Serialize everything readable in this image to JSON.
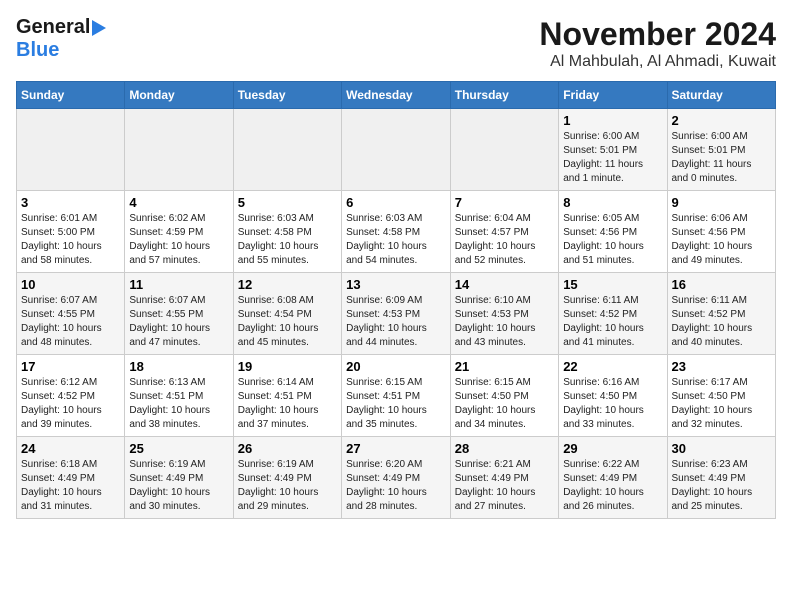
{
  "header": {
    "logo_line1": "General",
    "logo_line2": "Blue",
    "title": "November 2024",
    "subtitle": "Al Mahbulah, Al Ahmadi, Kuwait"
  },
  "days_of_week": [
    "Sunday",
    "Monday",
    "Tuesday",
    "Wednesday",
    "Thursday",
    "Friday",
    "Saturday"
  ],
  "weeks": [
    [
      {
        "day": "",
        "info": ""
      },
      {
        "day": "",
        "info": ""
      },
      {
        "day": "",
        "info": ""
      },
      {
        "day": "",
        "info": ""
      },
      {
        "day": "",
        "info": ""
      },
      {
        "day": "1",
        "info": "Sunrise: 6:00 AM\nSunset: 5:01 PM\nDaylight: 11 hours\nand 1 minute."
      },
      {
        "day": "2",
        "info": "Sunrise: 6:00 AM\nSunset: 5:01 PM\nDaylight: 11 hours\nand 0 minutes."
      }
    ],
    [
      {
        "day": "3",
        "info": "Sunrise: 6:01 AM\nSunset: 5:00 PM\nDaylight: 10 hours\nand 58 minutes."
      },
      {
        "day": "4",
        "info": "Sunrise: 6:02 AM\nSunset: 4:59 PM\nDaylight: 10 hours\nand 57 minutes."
      },
      {
        "day": "5",
        "info": "Sunrise: 6:03 AM\nSunset: 4:58 PM\nDaylight: 10 hours\nand 55 minutes."
      },
      {
        "day": "6",
        "info": "Sunrise: 6:03 AM\nSunset: 4:58 PM\nDaylight: 10 hours\nand 54 minutes."
      },
      {
        "day": "7",
        "info": "Sunrise: 6:04 AM\nSunset: 4:57 PM\nDaylight: 10 hours\nand 52 minutes."
      },
      {
        "day": "8",
        "info": "Sunrise: 6:05 AM\nSunset: 4:56 PM\nDaylight: 10 hours\nand 51 minutes."
      },
      {
        "day": "9",
        "info": "Sunrise: 6:06 AM\nSunset: 4:56 PM\nDaylight: 10 hours\nand 49 minutes."
      }
    ],
    [
      {
        "day": "10",
        "info": "Sunrise: 6:07 AM\nSunset: 4:55 PM\nDaylight: 10 hours\nand 48 minutes."
      },
      {
        "day": "11",
        "info": "Sunrise: 6:07 AM\nSunset: 4:55 PM\nDaylight: 10 hours\nand 47 minutes."
      },
      {
        "day": "12",
        "info": "Sunrise: 6:08 AM\nSunset: 4:54 PM\nDaylight: 10 hours\nand 45 minutes."
      },
      {
        "day": "13",
        "info": "Sunrise: 6:09 AM\nSunset: 4:53 PM\nDaylight: 10 hours\nand 44 minutes."
      },
      {
        "day": "14",
        "info": "Sunrise: 6:10 AM\nSunset: 4:53 PM\nDaylight: 10 hours\nand 43 minutes."
      },
      {
        "day": "15",
        "info": "Sunrise: 6:11 AM\nSunset: 4:52 PM\nDaylight: 10 hours\nand 41 minutes."
      },
      {
        "day": "16",
        "info": "Sunrise: 6:11 AM\nSunset: 4:52 PM\nDaylight: 10 hours\nand 40 minutes."
      }
    ],
    [
      {
        "day": "17",
        "info": "Sunrise: 6:12 AM\nSunset: 4:52 PM\nDaylight: 10 hours\nand 39 minutes."
      },
      {
        "day": "18",
        "info": "Sunrise: 6:13 AM\nSunset: 4:51 PM\nDaylight: 10 hours\nand 38 minutes."
      },
      {
        "day": "19",
        "info": "Sunrise: 6:14 AM\nSunset: 4:51 PM\nDaylight: 10 hours\nand 37 minutes."
      },
      {
        "day": "20",
        "info": "Sunrise: 6:15 AM\nSunset: 4:51 PM\nDaylight: 10 hours\nand 35 minutes."
      },
      {
        "day": "21",
        "info": "Sunrise: 6:15 AM\nSunset: 4:50 PM\nDaylight: 10 hours\nand 34 minutes."
      },
      {
        "day": "22",
        "info": "Sunrise: 6:16 AM\nSunset: 4:50 PM\nDaylight: 10 hours\nand 33 minutes."
      },
      {
        "day": "23",
        "info": "Sunrise: 6:17 AM\nSunset: 4:50 PM\nDaylight: 10 hours\nand 32 minutes."
      }
    ],
    [
      {
        "day": "24",
        "info": "Sunrise: 6:18 AM\nSunset: 4:49 PM\nDaylight: 10 hours\nand 31 minutes."
      },
      {
        "day": "25",
        "info": "Sunrise: 6:19 AM\nSunset: 4:49 PM\nDaylight: 10 hours\nand 30 minutes."
      },
      {
        "day": "26",
        "info": "Sunrise: 6:19 AM\nSunset: 4:49 PM\nDaylight: 10 hours\nand 29 minutes."
      },
      {
        "day": "27",
        "info": "Sunrise: 6:20 AM\nSunset: 4:49 PM\nDaylight: 10 hours\nand 28 minutes."
      },
      {
        "day": "28",
        "info": "Sunrise: 6:21 AM\nSunset: 4:49 PM\nDaylight: 10 hours\nand 27 minutes."
      },
      {
        "day": "29",
        "info": "Sunrise: 6:22 AM\nSunset: 4:49 PM\nDaylight: 10 hours\nand 26 minutes."
      },
      {
        "day": "30",
        "info": "Sunrise: 6:23 AM\nSunset: 4:49 PM\nDaylight: 10 hours\nand 25 minutes."
      }
    ]
  ]
}
